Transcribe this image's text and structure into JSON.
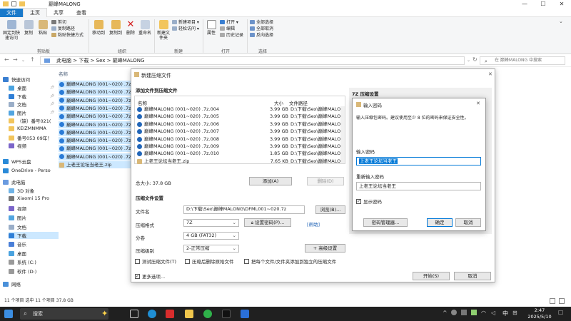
{
  "window": {
    "title": "巅峰MALONG"
  },
  "ribbon_tabs": [
    "文件",
    "主页",
    "共享",
    "查看"
  ],
  "ribbon": {
    "pin": "固定到快速访问",
    "copy": "复制",
    "paste": "粘贴",
    "cut": "剪切",
    "copy_path": "复制路径",
    "paste_shortcut": "粘贴快捷方式",
    "move_to": "移动到",
    "copy_to": "复制到",
    "delete": "删除",
    "rename": "重命名",
    "new_folder": "新建文件夹",
    "new_item": "新建项目",
    "easy_access": "轻松访问",
    "properties": "属性",
    "open": "打开",
    "edit": "编辑",
    "history": "历史记录",
    "select_all": "全部选择",
    "select_none": "全部取消",
    "invert_select": "反向选择",
    "groups": {
      "clipboard": "剪贴板",
      "organize": "组织",
      "new": "新建",
      "open": "打开",
      "select": "选择"
    }
  },
  "address": {
    "path": [
      "此电脑",
      "下载",
      "Sex",
      "巅峰MALONG"
    ],
    "search_placeholder": "在 巅峰MALONG 中搜索"
  },
  "nav": [
    {
      "label": "快速访问",
      "icon": "star-icon"
    },
    {
      "label": "桌面",
      "icon": "desktop-icon"
    },
    {
      "label": "下载",
      "icon": "download-icon"
    },
    {
      "label": "文档",
      "icon": "document-icon"
    },
    {
      "label": "图片",
      "icon": "picture-icon"
    },
    {
      "label": "（缺）番号021(",
      "icon": "folder-icon"
    },
    {
      "label": "KEIZMNMMA",
      "icon": "folder-icon"
    },
    {
      "label": "番号053 09年！",
      "icon": "folder-icon"
    },
    {
      "label": "视频",
      "icon": "video-icon"
    },
    {
      "label": "WPS云盘",
      "icon": "cloud-icon"
    },
    {
      "label": "OneDrive - Perso",
      "icon": "cloud-icon"
    },
    {
      "label": "此电脑",
      "icon": "computer-icon"
    },
    {
      "label": "3D 对象",
      "icon": "cube-icon"
    },
    {
      "label": "Xiaomi 15 Pro",
      "icon": "phone-icon"
    },
    {
      "label": "视频",
      "icon": "video-icon"
    },
    {
      "label": "图片",
      "icon": "picture-icon"
    },
    {
      "label": "文档",
      "icon": "document-icon"
    },
    {
      "label": "下载",
      "icon": "download-icon"
    },
    {
      "label": "音乐",
      "icon": "music-icon"
    },
    {
      "label": "桌面",
      "icon": "desktop-icon"
    },
    {
      "label": "系统 (C:)",
      "icon": "drive-icon"
    },
    {
      "label": "软件 (D:)",
      "icon": "drive-icon"
    },
    {
      "label": "网络",
      "icon": "network-icon"
    }
  ],
  "file_list": {
    "header": "名称",
    "rows": [
      "巅峰MALONG (001~020) .7z",
      "巅峰MALONG (001~020) .7z",
      "巅峰MALONG (001~020) .7z",
      "巅峰MALONG (001~020) .7z",
      "巅峰MALONG (001~020) .7z",
      "巅峰MALONG (001~020) .7z",
      "巅峰MALONG (001~020) .7z",
      "巅峰MALONG (001~020) .7z",
      "巅峰MALONG (001~020) .7z",
      "巅峰MALONG (001~020) .7z",
      "上老王论坛当老王.zip"
    ]
  },
  "status": "11 个项目    选中 11 个项目  37.8 GB",
  "compress_dialog": {
    "title": "新建压缩文件",
    "add_section": "添加文件到压缩文件",
    "col_name": "名称",
    "col_size": "大小",
    "col_path": "文件路径",
    "files": [
      {
        "name": "巅峰MALONG (001~020) .7z.004",
        "size": "3.99 GB",
        "path": "D:\\下载\\Sex\\巅峰MALONG"
      },
      {
        "name": "巅峰MALONG (001~020) .7z.005",
        "size": "3.99 GB",
        "path": "D:\\下载\\Sex\\巅峰MALONG"
      },
      {
        "name": "巅峰MALONG (001~020) .7z.006",
        "size": "3.99 GB",
        "path": "D:\\下载\\Sex\\巅峰MALONG"
      },
      {
        "name": "巅峰MALONG (001~020) .7z.007",
        "size": "3.99 GB",
        "path": "D:\\下载\\Sex\\巅峰MALONG"
      },
      {
        "name": "巅峰MALONG (001~020) .7z.008",
        "size": "3.99 GB",
        "path": "D:\\下载\\Sex\\巅峰MALONG"
      },
      {
        "name": "巅峰MALONG (001~020) .7z.009",
        "size": "3.99 GB",
        "path": "D:\\下载\\Sex\\巅峰MALONG"
      },
      {
        "name": "巅峰MALONG (001~020) .7z.010",
        "size": "1.85 GB",
        "path": "D:\\下载\\Sex\\巅峰MALONG"
      },
      {
        "name": "上老王论坛当老王.zip",
        "size": "7.65 KB",
        "path": "D:\\下载\\Sex\\巅峰MALONG"
      }
    ],
    "total_size": "总大小: 37.8 GB",
    "add_button": "添加(A)",
    "delete_button": "删除(D)",
    "settings_section": "压缩文件设置",
    "filename_label": "文件名",
    "filename_value": "D:\\下载\\Sex\\巅峰MALONG\\DFML001~020.7z",
    "browse_button": "浏览(B)...",
    "format_label": "压缩格式",
    "format_value": "7Z",
    "set_password_button": "设置密码(P)...",
    "help_link": "[帮助]",
    "split_label": "分卷",
    "split_value": "4 GB (FAT32)",
    "level_label": "压缩级别",
    "level_value": "2-正常压缩",
    "advanced_button": "+ 高级设置",
    "test_check": "测试压缩文件(T)",
    "delete_after_check": "压缩后删除原始文件",
    "separate_check": "把每个文件/文件夹添加到独立的压缩文件",
    "more_options": "更多选项...",
    "start_button": "开始(S)",
    "cancel_button": "取消",
    "settings_panel_title": "7Z 压缩设置"
  },
  "password_dialog": {
    "title": "输入密码",
    "hint": "输入压缩包密码。建议使用至少 8 位的密码来保证安全性。",
    "enter_label": "输入密码",
    "enter_value": "上老王论坛当老王",
    "reenter_label": "重新输入密码",
    "reenter_value": "上老王论坛当老王",
    "show_password": "显示密码",
    "manager_button": "密码管理器...",
    "ok_button": "确定",
    "cancel_button": "取消"
  },
  "taskbar": {
    "search": "搜索",
    "time": "2:47",
    "date": "2025/5/10",
    "ime": "中"
  },
  "colors": {
    "accent": "#0078d7",
    "file_tab": "#1979ca",
    "selection": "#cce8ff",
    "taskbar": "#202020"
  }
}
